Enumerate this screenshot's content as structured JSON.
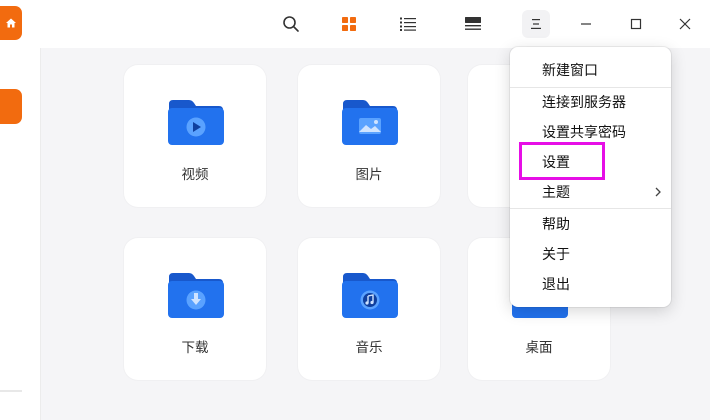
{
  "icons": {
    "home": "home-icon",
    "search": "search-icon",
    "grid_view": "grid-view-icon",
    "list_view": "list-view-icon",
    "detail_view": "detail-view-icon",
    "menu": "menu-icon",
    "minimize": "minimize-icon",
    "maximize": "maximize-icon",
    "close": "close-icon"
  },
  "colors": {
    "accent": "#f26b0f",
    "folder": "#1f6ef0",
    "highlight_box": "#e60ee6"
  },
  "folders": [
    {
      "label": "视频",
      "icon": "video-folder-icon"
    },
    {
      "label": "图片",
      "icon": "picture-folder-icon"
    },
    {
      "label": "",
      "icon": "folder-icon"
    },
    {
      "label": "下载",
      "icon": "download-folder-icon"
    },
    {
      "label": "音乐",
      "icon": "music-folder-icon"
    },
    {
      "label": "桌面",
      "icon": "desktop-folder-icon"
    }
  ],
  "menu": {
    "items": [
      {
        "label": "新建窗口"
      },
      {
        "label": "连接到服务器"
      },
      {
        "label": "设置共享密码"
      },
      {
        "label": "设置"
      },
      {
        "label": "主题"
      },
      {
        "label": "帮助"
      },
      {
        "label": "关于"
      },
      {
        "label": "退出"
      }
    ]
  }
}
